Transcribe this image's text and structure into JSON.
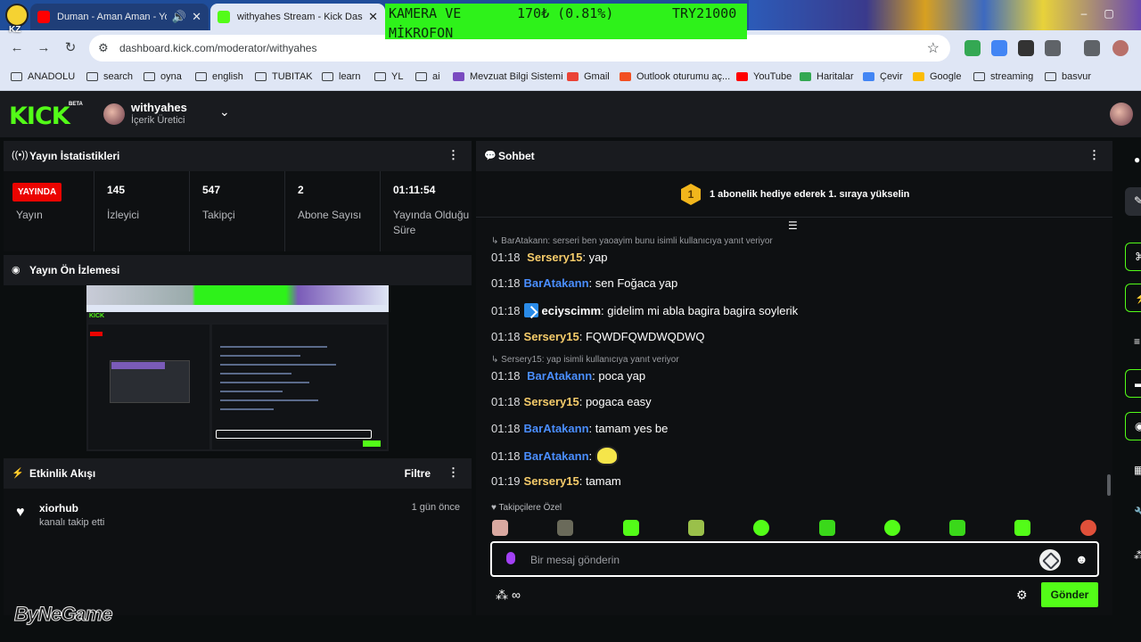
{
  "browser": {
    "tabs": [
      {
        "title": "Duman - Aman Aman - You",
        "icon": "youtube-icon"
      },
      {
        "title": "withyahes Stream - Kick Dashb",
        "icon": "kick-icon"
      }
    ],
    "overlay_badge": "KZ",
    "ticker": {
      "line1": "KAMERA VE",
      "line2": "MİKROFON",
      "price": "170₺ (0.81%)",
      "symbol": "TRY21000"
    },
    "url": "dashboard.kick.com/moderator/withyahes",
    "bookmarks": [
      "ANADOLU",
      "search",
      "oyna",
      "english",
      "TUBITAK",
      "learn",
      "YL",
      "ai",
      "Mevzuat Bilgi Sistemi",
      "Gmail",
      "Outlook oturumu aç...",
      "YouTube",
      "Haritalar",
      "Çevir",
      "Google",
      "streaming",
      "basvur"
    ]
  },
  "header": {
    "logo": "KICK",
    "beta": "BETA",
    "username": "withyahes",
    "role": "İçerik Üretici"
  },
  "stream_stats": {
    "title": "Yayın İstatistikleri",
    "live_badge": "YAYINDA",
    "items": [
      {
        "value": "",
        "label": "Yayın"
      },
      {
        "value": "145",
        "label": "İzleyici"
      },
      {
        "value": "547",
        "label": "Takipçi"
      },
      {
        "value": "2",
        "label": "Abone Sayısı"
      },
      {
        "value": "01:11:54",
        "label": "Yayında Olduğu Süre"
      }
    ]
  },
  "preview": {
    "title": "Yayın Ön İzlemesi"
  },
  "activity": {
    "title": "Etkinlik Akışı",
    "filter_label": "Filtre",
    "items": [
      {
        "name": "xiorhub",
        "desc": "kanalı takip etti",
        "time": "1 gün önce"
      }
    ]
  },
  "chat": {
    "title": "Sohbet",
    "gift_banner": {
      "badge": "1",
      "text": "1 abonelik hediye ederek 1. sıraya yükselin"
    },
    "reply1": "BarAtakann: serseri ben yaoayim bunu isimli kullanıcıya yanıt veriyor",
    "reply2": "Sersery15: yap isimli kullanıcıya yanıt veriyor",
    "messages": [
      {
        "time": "01:18",
        "user": "Sersery15",
        "color": "#f6cc6a",
        "text": "yap"
      },
      {
        "time": "01:18",
        "user": "BarAtakann",
        "color": "#4a8eff",
        "text": "sen Foğaca yap"
      },
      {
        "time": "01:18",
        "user": "eciyscimm",
        "color": "#ffffff",
        "text": "gidelim mi abla bagira bagira soylerik"
      },
      {
        "time": "01:18",
        "user": "Sersery15",
        "color": "#f6cc6a",
        "text": "FQWDFQWDWQDWQ"
      },
      {
        "time": "01:18",
        "user": "BarAtakann",
        "color": "#4a8eff",
        "text": "poca yap"
      },
      {
        "time": "01:18",
        "user": "Sersery15",
        "color": "#f6cc6a",
        "text": "pogaca easy"
      },
      {
        "time": "01:18",
        "user": "BarAtakann",
        "color": "#4a8eff",
        "text": "tamam yes be"
      },
      {
        "time": "01:18",
        "user": "BarAtakann",
        "color": "#4a8eff",
        "text": ""
      },
      {
        "time": "01:19",
        "user": "Sersery15",
        "color": "#f6cc6a",
        "text": "tamam"
      }
    ],
    "emote_label": "Takipçilere Özel",
    "input_placeholder": "Bir mesaj gönderin",
    "send_label": "Gönder"
  },
  "watermark": "ByNeGame",
  "colors": {
    "accent": "#53fc18",
    "live": "#eb0400",
    "chat_blue": "#4a8eff",
    "chat_yellow": "#f6cc6a"
  }
}
